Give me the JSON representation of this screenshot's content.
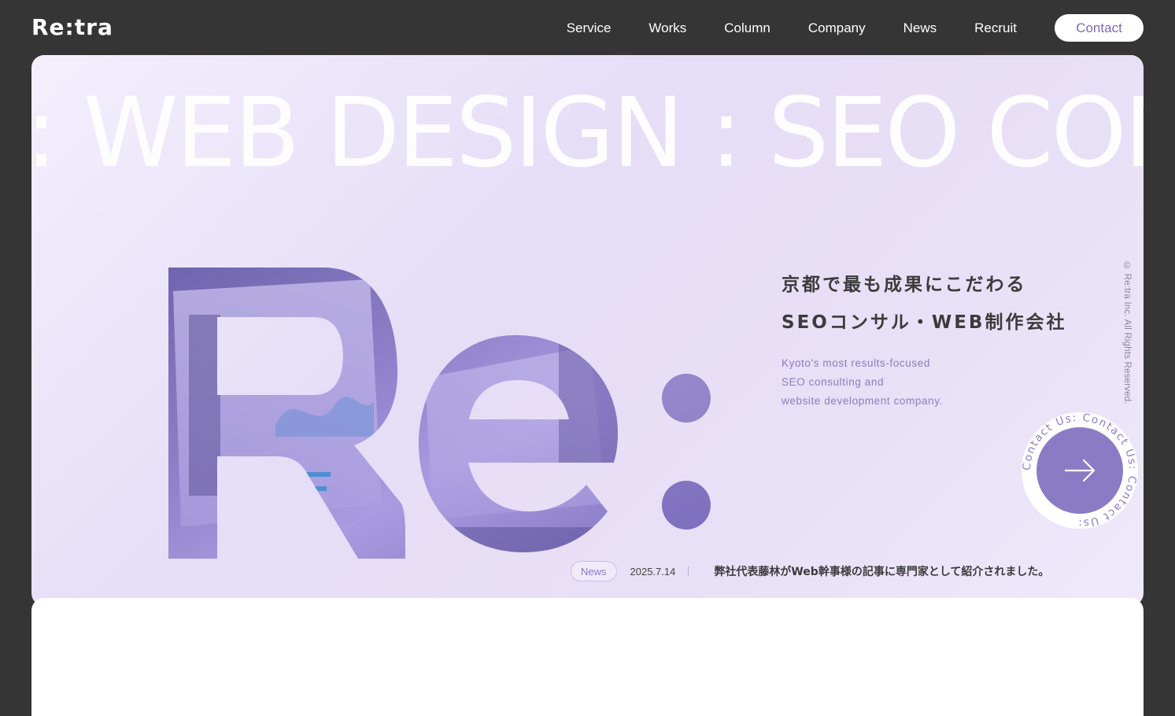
{
  "header": {
    "logo": "Re:tra",
    "nav": [
      "Service",
      "Works",
      "Column",
      "Company",
      "News",
      "Recruit"
    ],
    "contact_label": "Contact"
  },
  "hero": {
    "marquee": ": WEB DESIGN : SEO CON",
    "tagline_line1": "京都で最も成果にこだわる",
    "tagline_line2": "SEOコンサル・WEB制作会社",
    "sub_line1": "Kyoto's most results-focused",
    "sub_line2": "SEO consulting and",
    "sub_line3": "website development company.",
    "copyright": "© Re:tra Inc. All Rights Reserved.",
    "circle_text": "Contact Us: Contact Us: Contact Us: ",
    "news": {
      "tag": "News",
      "date": "2025.7.14",
      "text": "弊社代表藤林がWeb幹事様の記事に専門家として紹介されました。"
    }
  },
  "colors": {
    "background": "#353535",
    "accent": "#8a7cc4",
    "hero_bg": "#e8e0f6"
  },
  "icons": {
    "arrow": "arrow-right-icon"
  }
}
